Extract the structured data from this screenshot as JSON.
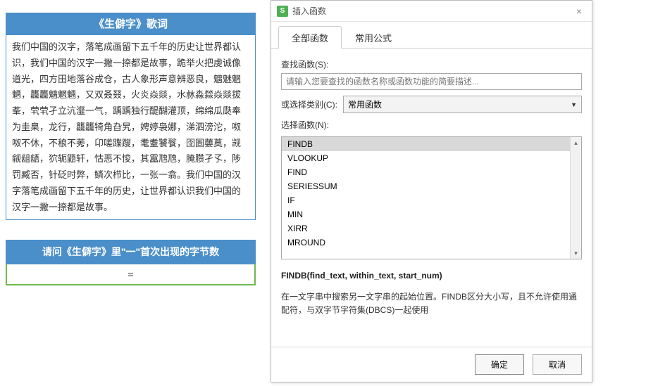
{
  "left": {
    "title": "《生僻字》歌词",
    "lyrics": "我们中国的汉字，落笔成画留下五千年的历史让世界都认识，我们中国的汉字一撇一捺都是故事，跪举火把虔诚像道光，四方田地落谷成仓，古人象形声意辨恶良，魑魅魍魉，龘龘魑魍魎，又双叒叕，火炎焱燚，水沝淼㵘焱燚拔莑，茕茕孑立沆瀣一气，踽踽独行醍醐灌顶，绵绵瓜瓞奉为圭臬，龙行，龘龘犄角旮旯，娉婷袅娜，涕泗滂沱，呶呶不休，不稂不莠，卬嗟蹀躞，耄耋饕餮，囹圄蘡薁，觊觎龃龉，狖轭鼯轩，怙恶不悛，其靁虺虺，腌臜孑孓，陟罚臧否，针砭时弊，鳞次栉比，一张一翕。我们中国的汉字落笔成画留下五千年的历史，让世界都认识我们中国的汉字一撇一捺都是故事。",
    "question": "请问《生僻字》里\"一\"首次出现的字节数",
    "answer": "="
  },
  "dialog": {
    "title": "插入函数",
    "close": "×",
    "tabs": {
      "all": "全部函数",
      "common": "常用公式"
    },
    "searchLabel": "查找函数(S):",
    "searchPlaceholder": "请输入您要查找的函数名称或函数功能的简要描述...",
    "categoryLabel": "或选择类别(C):",
    "categoryValue": "常用函数",
    "selectLabel": "选择函数(N):",
    "functions": [
      "FINDB",
      "VLOOKUP",
      "FIND",
      "SERIESSUM",
      "IF",
      "MIN",
      "XIRR",
      "MROUND"
    ],
    "syntax": "FINDB(find_text, within_text, start_num)",
    "description": "在一文字串中搜索另一文字串的起始位置。FINDB区分大小写，且不允许使用通配符，与双字节字符集(DBCS)一起使用",
    "ok": "确定",
    "cancel": "取消"
  },
  "chart_data": null
}
